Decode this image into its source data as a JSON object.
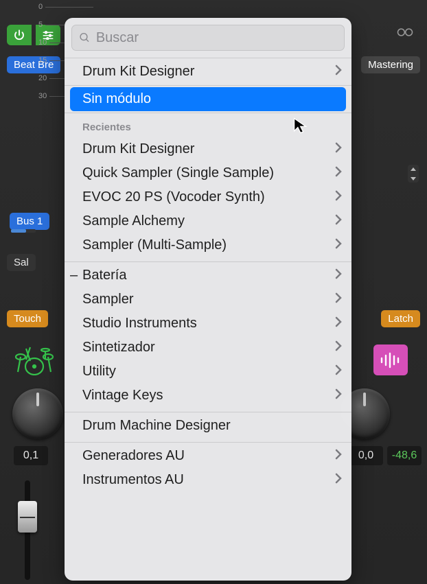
{
  "background": {
    "beat_label": "Beat Bre",
    "mastering_label": "Mastering",
    "bus_label": "Bus 1",
    "sal_label": "Sal",
    "touch_label": "Touch",
    "latch_label": "Latch",
    "num_left": "0,1",
    "num_right1": "0,0",
    "num_right2": "-48,6",
    "ticks": [
      "0",
      "5",
      "10",
      "15",
      "20",
      "30"
    ]
  },
  "popover": {
    "search_placeholder": "Buscar",
    "top_item": "Drum Kit Designer",
    "selected_item": "Sin módulo",
    "recents_label": "Recientes",
    "recents": [
      "Drum Kit Designer",
      "Quick Sampler (Single Sample)",
      "EVOC 20 PS (Vocoder Synth)",
      "Sample Alchemy",
      "Sampler (Multi-Sample)"
    ],
    "categories": [
      "Batería",
      "Sampler",
      "Studio Instruments",
      "Sintetizador",
      "Utility",
      "Vintage Keys"
    ],
    "drum_machine": "Drum Machine Designer",
    "au": [
      "Generadores AU",
      "Instrumentos AU"
    ]
  }
}
